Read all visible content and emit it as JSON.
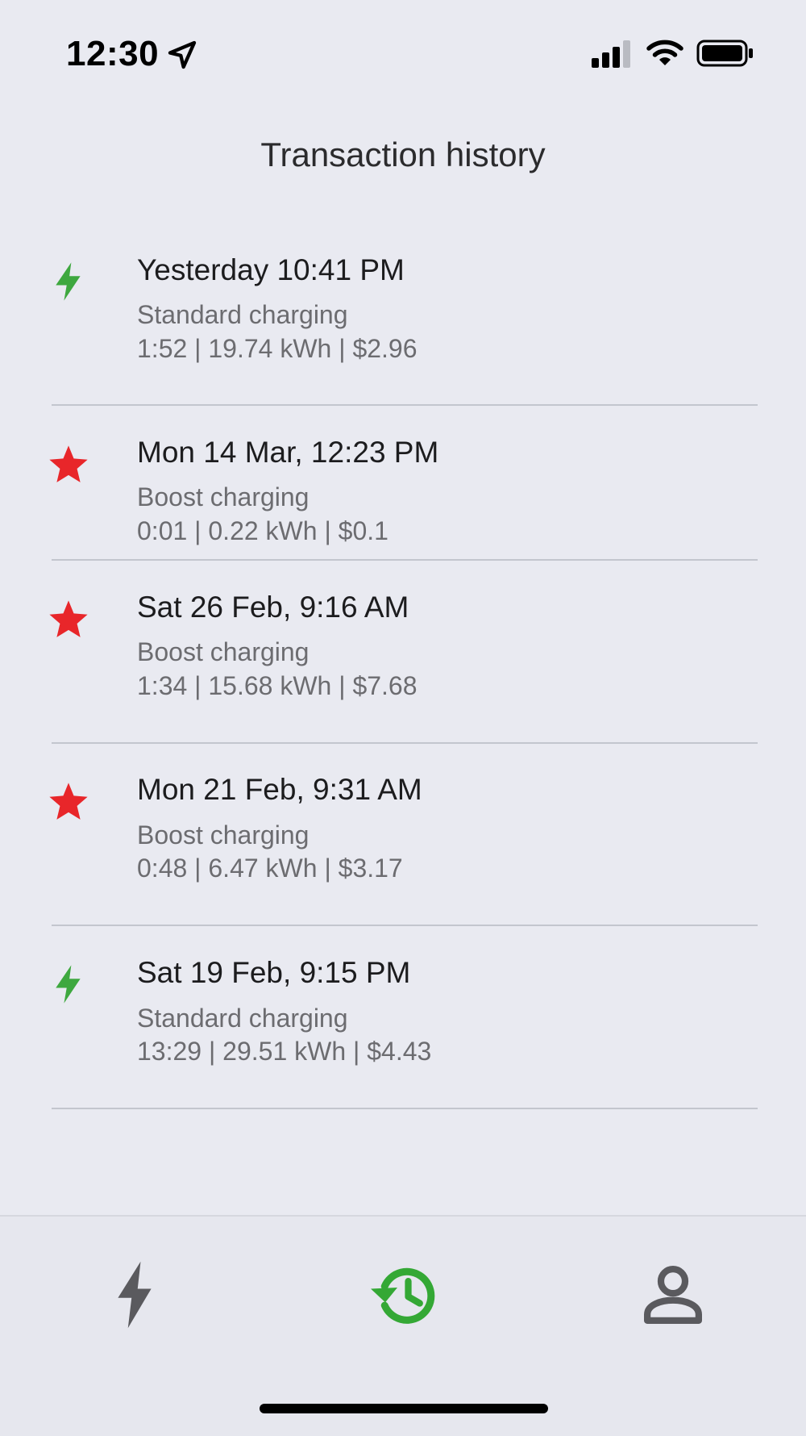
{
  "status_bar": {
    "time": "12:30"
  },
  "title": "Transaction history",
  "colors": {
    "standard": "#3ea83f",
    "boost": "#e8262a",
    "nav_active": "#34a835",
    "nav_inactive": "#5a5a5e"
  },
  "transactions": [
    {
      "icon": "bolt-icon",
      "date": "Yesterday 10:41 PM",
      "type": "Standard charging",
      "stats": "1:52 | 19.74 kWh | $2.96"
    },
    {
      "icon": "star-icon",
      "date": "Mon 14 Mar, 12:23 PM",
      "type": "Boost charging",
      "stats": "0:01 | 0.22 kWh | $0.1"
    },
    {
      "icon": "star-icon",
      "date": "Sat 26 Feb, 9:16 AM",
      "type": "Boost charging",
      "stats": "1:34 | 15.68 kWh | $7.68"
    },
    {
      "icon": "star-icon",
      "date": "Mon 21 Feb, 9:31 AM",
      "type": "Boost charging",
      "stats": "0:48 | 6.47 kWh | $3.17"
    },
    {
      "icon": "bolt-icon",
      "date": "Sat 19 Feb, 9:15 PM",
      "type": "Standard charging",
      "stats": "13:29 | 29.51 kWh | $4.43"
    }
  ],
  "bottom_nav": {
    "items": [
      {
        "icon": "bolt-icon",
        "active": false
      },
      {
        "icon": "history-icon",
        "active": true
      },
      {
        "icon": "profile-icon",
        "active": false
      }
    ]
  }
}
